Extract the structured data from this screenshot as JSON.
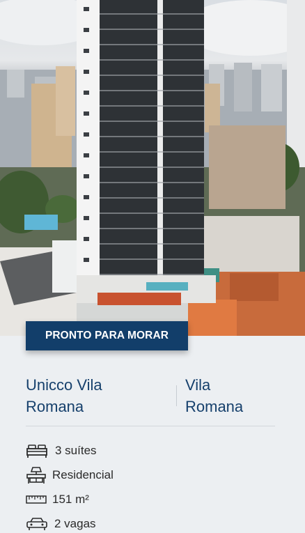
{
  "listing": {
    "badge": "PRONTO PARA MORAR",
    "name_line1": "Unicco Vila",
    "name_line2": "Romana",
    "neighborhood_line1": "Vila",
    "neighborhood_line2": "Romana"
  },
  "features": [
    {
      "icon": "bed-icon",
      "label": "3 suítes"
    },
    {
      "icon": "desk-lamp-icon",
      "label": "Residencial"
    },
    {
      "icon": "ruler-icon",
      "label": "151 m²"
    },
    {
      "icon": "car-icon",
      "label": "2 vagas"
    }
  ],
  "colors": {
    "badge_bg": "#123e6a",
    "title": "#16406c",
    "card_bg": "#eceff2"
  }
}
